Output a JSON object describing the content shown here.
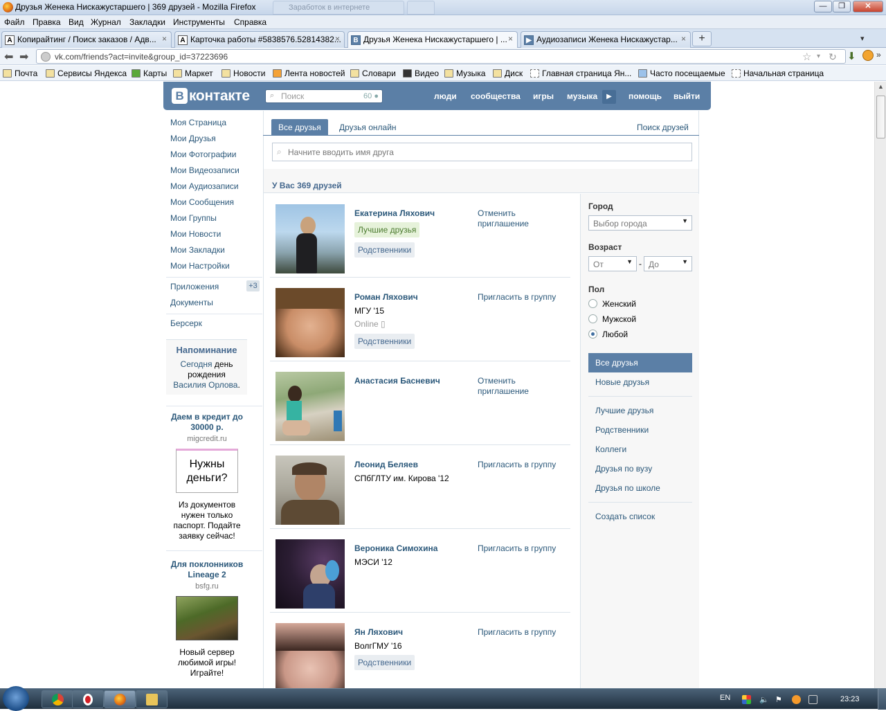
{
  "window": {
    "title": "Друзья Женека Нискажустаршего | 369 друзей - Mozilla Firefox",
    "ghost_tab": "Заработок в интернете"
  },
  "menubar": [
    "Файл",
    "Правка",
    "Вид",
    "Журнал",
    "Закладки",
    "Инструменты",
    "Справка"
  ],
  "tabs": [
    {
      "label": "Копирайтинг / Поиск заказов / Адв...",
      "icon": "A"
    },
    {
      "label": "Карточка работы #5838576.52814382...",
      "icon": "A"
    },
    {
      "label": "Друзья Женека Нискажустаршего | ...",
      "icon": "B",
      "active": true
    },
    {
      "label": "Аудиозаписи Женека Нискажустар...",
      "icon": "▶"
    }
  ],
  "url": "vk.com/friends?act=invite&group_id=37223696",
  "bookmarks": [
    "Почта",
    "Сервисы Яндекса",
    "Карты",
    "Маркет",
    "Новости",
    "Лента новостей",
    "Словари",
    "Видео",
    "Музыка",
    "Диск",
    "Главная страница Ян...",
    "Часто посещаемые",
    "Начальная страница"
  ],
  "vk": {
    "logo_letter": "В",
    "logo_text": "контакте",
    "search_placeholder": "Поиск",
    "search_count": "60",
    "menu": [
      "люди",
      "сообщества",
      "игры",
      "музыка",
      "помощь",
      "выйти"
    ]
  },
  "left_menu": [
    "Моя Страница",
    "Мои Друзья",
    "Мои Фотографии",
    "Мои Видеозаписи",
    "Мои Аудиозаписи",
    "Мои Сообщения",
    "Мои Группы",
    "Мои Новости",
    "Мои Закладки",
    "Мои Настройки"
  ],
  "left_menu2": {
    "apps": "Приложения",
    "apps_badge": "+3",
    "docs": "Документы",
    "berserk": "Берсерк"
  },
  "reminder": {
    "title": "Напоминание",
    "today": "Сегодня",
    "text": "день рождения",
    "name": "Василия Орлова",
    "dot": "."
  },
  "ads": [
    {
      "title": "Даем в кредит до 30000 р.",
      "site": "migcredit.ru",
      "image_text": "Нужны деньги?",
      "text": "Из документов нужен только паспорт. Подайте заявку сейчас!"
    },
    {
      "title": "Для поклонников Lineage 2",
      "site": "bsfg.ru",
      "text": "Новый сервер любимой игры! Играйте!"
    }
  ],
  "friends_tabs": {
    "all": "Все друзья",
    "online": "Друзья онлайн",
    "find": "Поиск друзей"
  },
  "friend_search_placeholder": "Начните вводить имя друга",
  "count_text": "У Вас 369 друзей",
  "friends": [
    {
      "name": "Екатерина Ляхович",
      "action": "Отменить приглашение",
      "tags": [
        "Лучшие друзья",
        "Родственники"
      ]
    },
    {
      "name": "Роман Ляхович",
      "info": "МГУ '15",
      "online": "Online",
      "action": "Пригласить в группу",
      "tags": [
        "Родственники"
      ]
    },
    {
      "name": "Анастасия Басневич",
      "action": "Отменить приглашение",
      "tags": []
    },
    {
      "name": "Леонид Беляев",
      "info": "СПбГЛТУ им. Кирова '12",
      "action": "Пригласить в группу",
      "tags": []
    },
    {
      "name": "Вероника Симохина",
      "info": "МЭСИ '12",
      "action": "Пригласить в группу",
      "tags": []
    },
    {
      "name": "Ян Ляхович",
      "info": "ВолгГМУ '16",
      "action": "Пригласить в группу",
      "tags": [
        "Родственники"
      ]
    }
  ],
  "filters": {
    "city_label": "Город",
    "city_select": "Выбор города",
    "age_label": "Возраст",
    "age_from": "От",
    "age_dash": "-",
    "age_to": "До",
    "sex_label": "Пол",
    "sex_options": [
      "Женский",
      "Мужской",
      "Любой"
    ],
    "sex_selected": "Любой",
    "lists": [
      "Все друзья",
      "Новые друзья",
      "Лучшие друзья",
      "Родственники",
      "Коллеги",
      "Друзья по вузу",
      "Друзья по школе",
      "Создать список"
    ]
  },
  "taskbar": {
    "lang": "EN",
    "time": "23:23"
  }
}
